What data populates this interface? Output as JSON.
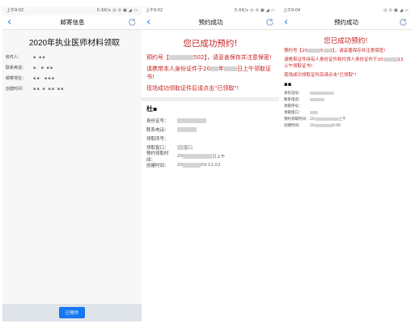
{
  "phone1": {
    "status_time": "上午9:02",
    "status_icons": "0.6K/s ◷ ⊙ ▣ ◢ ▭",
    "title": "邮寄信息",
    "heading": "2020年执业医师材料领取",
    "fields": [
      {
        "label": "收件人：",
        "value": "▪ ▪▪"
      },
      {
        "label": "联系电话：",
        "value": "▪· ▪ ▪▪"
      },
      {
        "label": "邮寄地址：",
        "value": "▪▪· ▪▪▪"
      },
      {
        "label": "创建时间：",
        "value": "▪▪ ▪ ▪▪ ▪▪"
      }
    ],
    "button": "已寄件"
  },
  "phone2": {
    "status_time": "上午9:02",
    "status_icons": "0.6K/s ◷ ⊙ ▣ ◢ ▭",
    "title": "预约成功",
    "headline": "您已成功预约!",
    "notice1_pre": "预约号【",
    "notice1_mid": "5",
    "notice1_post": "02】，请妥善保存并注意保密!",
    "notice2_pre": "请携带本人身份证件于20",
    "notice2_mid": "年",
    "notice2_post": "日上午领取证书!",
    "notice3": "现场成功领取证件后请点击\"已领取\"!",
    "name": "杜▪",
    "rows": [
      {
        "label": "身份证号：",
        "value": ""
      },
      {
        "label": "联系电话：",
        "value": ""
      },
      {
        "label": "领取序号：",
        "value": ""
      },
      {
        "label": "领取窗口：",
        "value": "窗口"
      },
      {
        "label": "预约领取时间：",
        "value_pre": "20",
        "value_post": "日上午"
      },
      {
        "label": "创建时间：",
        "value_pre": "20",
        "value_post": "09:11:02"
      }
    ]
  },
  "phone3": {
    "status_time": "上午9:04",
    "status_icons": "◷ ⊙ ▣ ◢ ▭",
    "title": "预约成功",
    "headline": "您已成功预约!",
    "notice1_pre": "预约号【20",
    "notice1_mid": "5",
    "notice1_post": "1】，请妥善保存并注意保密!",
    "notice2_pre": "请携带证件持有人身份证件和代领人身份证件于20",
    "notice2_mid": "13",
    "notice2_post": "上午领取证书!",
    "notice3": "现场成功领取证件后请点击\"已领取\"!",
    "name": "▪▪",
    "rows": [
      {
        "label": "身份证号：",
        "value": ""
      },
      {
        "label": "联系电话：",
        "value": ""
      },
      {
        "label": "领取序号：",
        "value": ""
      },
      {
        "label": "领取窗口：",
        "value": ""
      },
      {
        "label": "预约领取时间：",
        "value_pre": "20",
        "value_post": "上午"
      },
      {
        "label": "创建时间：",
        "value_pre": "20",
        "value_post": "0:08"
      }
    ]
  },
  "colors": {
    "accent": "#1e7be6",
    "notice_red": "#c81e1e",
    "button_blue": "#1877f2"
  },
  "icons": {
    "back": "chevron-left-icon",
    "refresh": "refresh-icon"
  }
}
